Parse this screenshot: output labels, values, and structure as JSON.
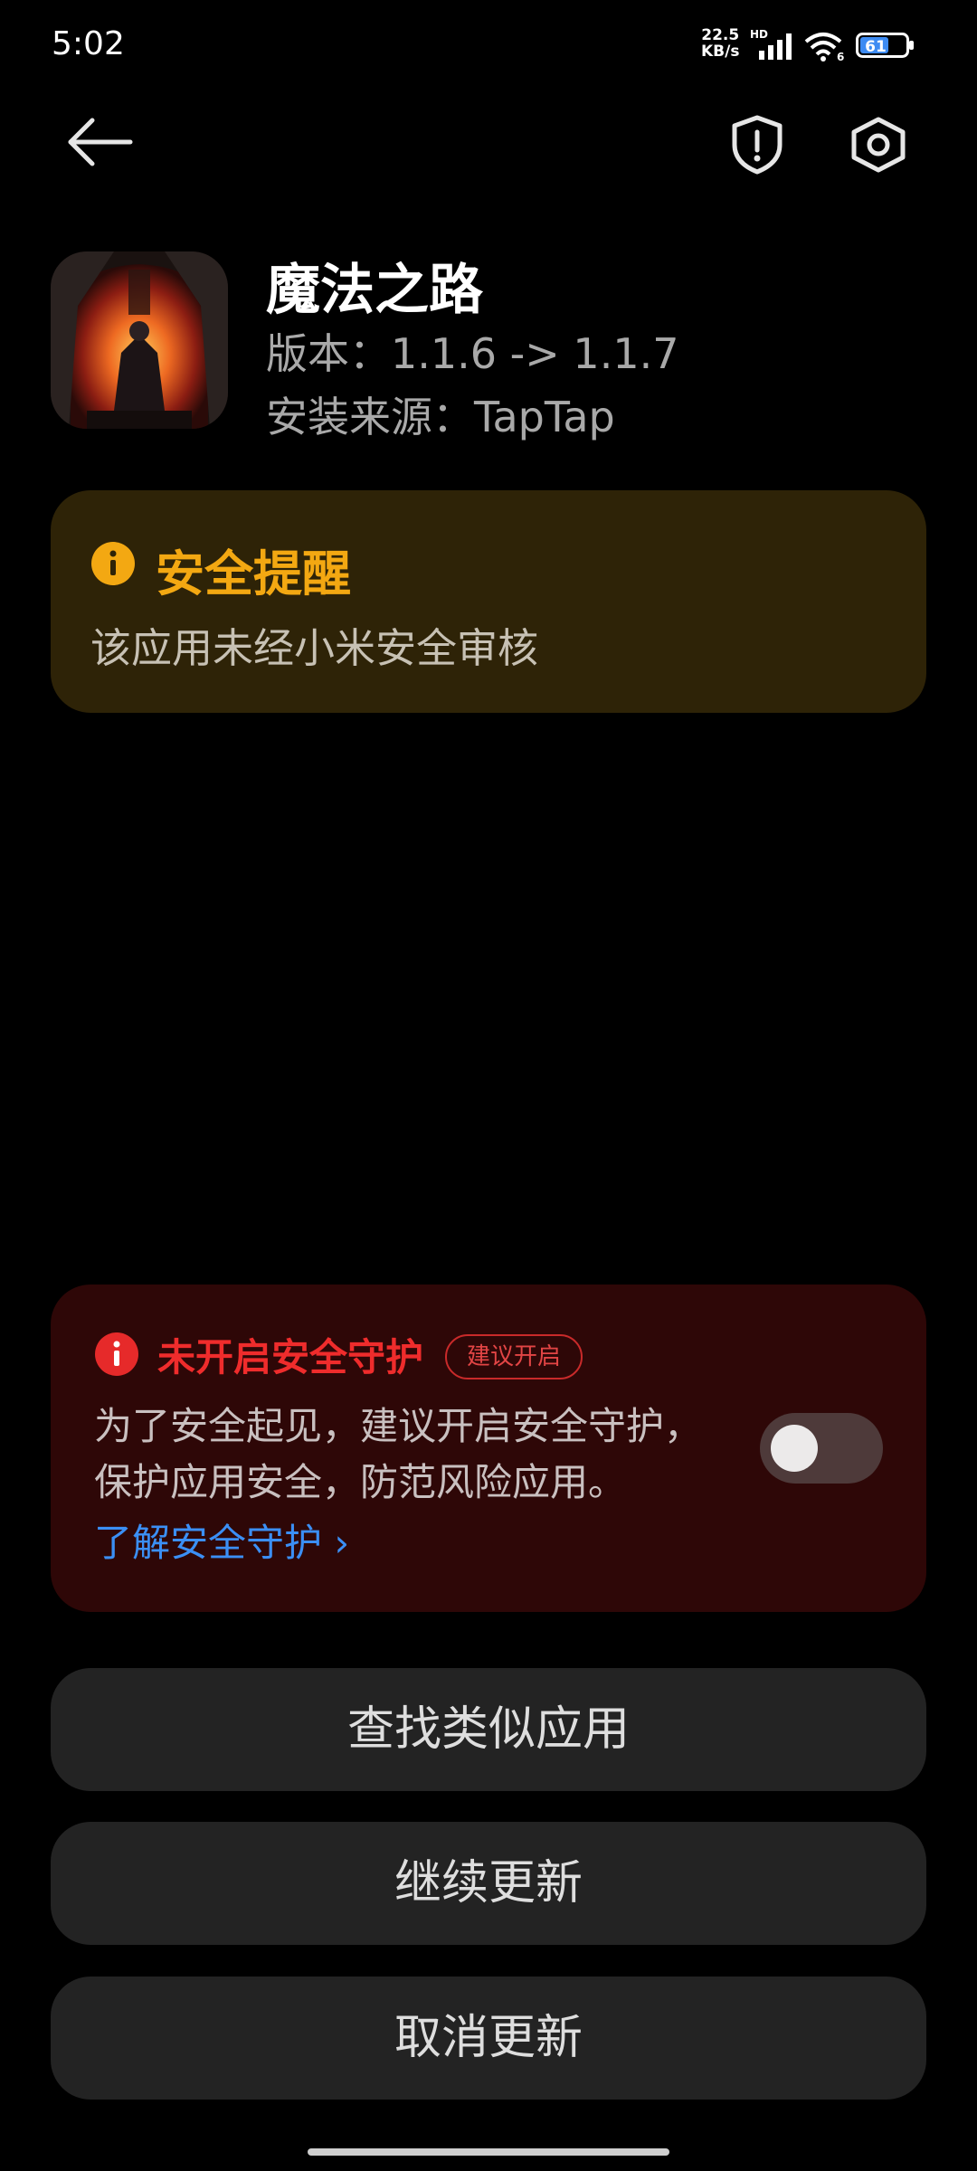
{
  "status_bar": {
    "time": "5:02",
    "net_speed_value": "22.5",
    "net_speed_unit": "KB/s",
    "hd_label": "HD",
    "network_gen": "6",
    "battery_level": "61"
  },
  "top_bar": {
    "back_icon": "arrow-left-icon",
    "shield_icon": "shield-alert-icon",
    "settings_icon": "gear-icon"
  },
  "app": {
    "name": "魔法之路",
    "version": "版本：1.1.6 -> 1.1.7",
    "source": "安装来源：TapTap"
  },
  "security_reminder": {
    "title": "安全提醒",
    "body": "该应用未经小米安全审核",
    "color": "#f3a812"
  },
  "protection": {
    "title": "未开启安全守护",
    "badge": "建议开启",
    "desc_line1": "为了安全起见，建议开启安全守护，",
    "desc_line2": "保护应用安全，防范风险应用。",
    "link": "了解安全守护 ›",
    "toggle_on": false,
    "title_color": "#ef2c2c",
    "link_color": "#3b8ff5"
  },
  "actions": {
    "find_similar": "查找类似应用",
    "continue_update": "继续更新",
    "cancel_update": "取消更新"
  }
}
